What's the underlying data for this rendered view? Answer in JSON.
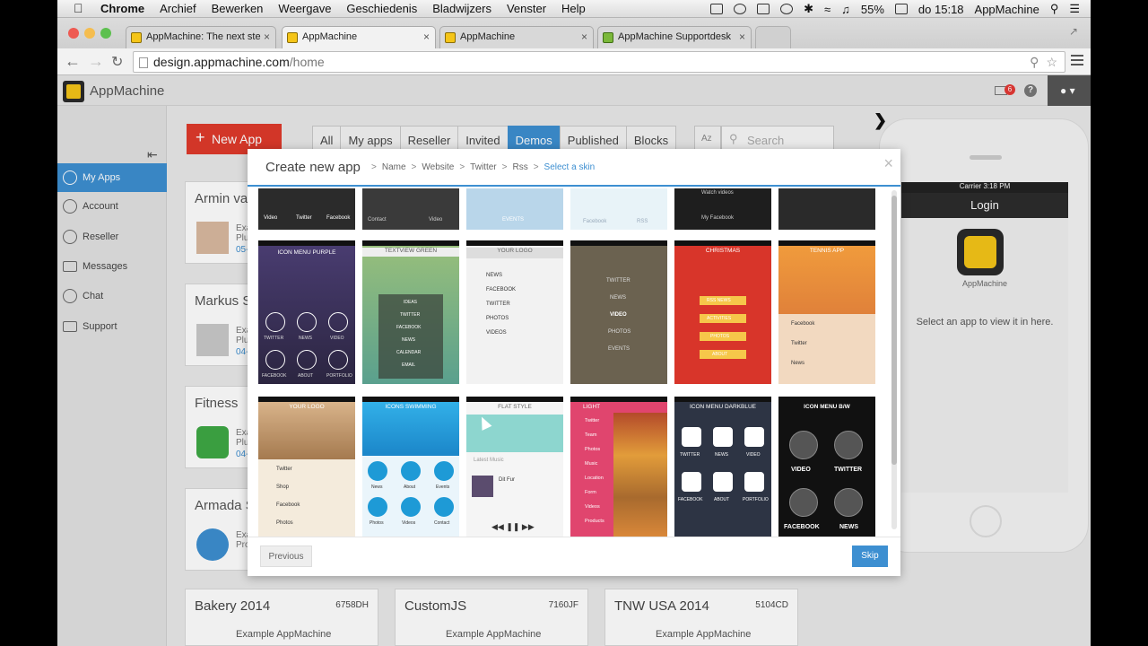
{
  "menubar": {
    "items": [
      "Chrome",
      "Archief",
      "Bewerken",
      "Weergave",
      "Geschiedenis",
      "Bladwijzers",
      "Venster",
      "Help"
    ],
    "battery": "55%",
    "clock": "do 15:18",
    "user": "AppMachine"
  },
  "tabs": [
    {
      "label": "AppMachine: The next ste"
    },
    {
      "label": "AppMachine"
    },
    {
      "label": "AppMachine"
    },
    {
      "label": "AppMachine Supportdesk"
    }
  ],
  "address": {
    "domain": "design.appmachine.com",
    "path": "/home"
  },
  "header": {
    "brand": "AppMachine",
    "mail_count": "6",
    "help": "?"
  },
  "sidebar": {
    "items": [
      {
        "label": "My Apps"
      },
      {
        "label": "Account"
      },
      {
        "label": "Reseller"
      },
      {
        "label": "Messages"
      },
      {
        "label": "Chat"
      },
      {
        "label": "Support"
      }
    ]
  },
  "main": {
    "new_app": "New App",
    "filters": [
      "All",
      "My apps",
      "Reseller",
      "Invited",
      "Demos",
      "Published",
      "Blocks"
    ],
    "sort_label": "Az",
    "search_placeholder": "Search",
    "cards": [
      {
        "title": "Armin va",
        "sub": "Exa\nPlu",
        "date": "05-"
      },
      {
        "title": "Markus S",
        "sub": "Exa\nPlu",
        "date": "04-"
      },
      {
        "title": "Fitness",
        "sub": "Exa\nPlu",
        "date": "04-"
      },
      {
        "title": "Armada S",
        "sub": "Exa\nPro",
        "date": ""
      }
    ],
    "bottom_cards": [
      {
        "title": "Bakery 2014",
        "code": "6758DH",
        "sub": "Example AppMachine"
      },
      {
        "title": "CustomJS",
        "code": "7160JF",
        "sub": "Example AppMachine"
      },
      {
        "title": "TNW USA 2014",
        "code": "5104CD",
        "sub": "Example AppMachine"
      }
    ]
  },
  "phone": {
    "carrier": "Carrier",
    "time": "3:18 PM",
    "screen_title": "Login",
    "app_name": "AppMachine",
    "hint": "Select an app to view it in here."
  },
  "modal": {
    "title": "Create new app",
    "steps": [
      "Name",
      "Website",
      "Twitter",
      "Rss",
      "Select a skin"
    ],
    "previous": "Previous",
    "skip": "Skip",
    "skins_row1": [
      {
        "labels": [
          "Video",
          "Twitter",
          "Facebook"
        ]
      },
      {
        "labels": [
          "Contact",
          "Video"
        ]
      },
      {
        "labels": [
          "EVENTS"
        ]
      },
      {
        "labels": [
          "Facebook",
          "RSS"
        ]
      },
      {
        "labels": [
          "Watch videos",
          "My Facebook"
        ]
      },
      {
        "labels": []
      }
    ],
    "skins_row2": [
      {
        "title": "ICON MENU PURPLE",
        "labels": [
          "TWITTER",
          "NEWS",
          "VIDEO",
          "FACEBOOK",
          "ABOUT",
          "PORTFOLIO"
        ]
      },
      {
        "title": "TEXTVIEW GREEN",
        "labels": [
          "IDEAS",
          "TWITTER",
          "FACEBOOK",
          "NEWS",
          "CALENDAR",
          "EMAIL"
        ]
      },
      {
        "title": "YOUR LOGO",
        "labels": [
          "NEWS",
          "FACEBOOK",
          "TWITTER",
          "PHOTOS",
          "VIDEOS"
        ]
      },
      {
        "title": "",
        "labels": [
          "TWITTER",
          "NEWS",
          "VIDEO",
          "PHOTOS",
          "EVENTS"
        ]
      },
      {
        "title": "CHRISTMAS",
        "labels": [
          "RSS NEWS",
          "ACTIVITIES",
          "PHOTOS",
          "ABOUT"
        ]
      },
      {
        "title": "Tennis app",
        "labels": [
          "Facebook",
          "Twitter",
          "News"
        ]
      }
    ],
    "skins_row3": [
      {
        "title": "Your logo",
        "labels": [
          "Twitter",
          "Shop",
          "Facebook",
          "Photos"
        ]
      },
      {
        "title": "ICONS SWIMMING",
        "labels": [
          "News",
          "About",
          "Events",
          "Photos",
          "Videos",
          "Contact"
        ]
      },
      {
        "title": "Flat Style",
        "labels": [
          "Latest Music",
          "Dit Fur"
        ]
      },
      {
        "title": "Light",
        "labels": [
          "Twitter",
          "Team",
          "Photos",
          "Music",
          "Location",
          "Form",
          "Videos",
          "Products"
        ]
      },
      {
        "title": "Icon menu DarkBlue",
        "labels": [
          "TWITTER",
          "NEWS",
          "VIDEO",
          "FACEBOOK",
          "ABOUT",
          "PORTFOLIO"
        ]
      },
      {
        "title": "ICON MENU B/W",
        "labels": [
          "VIDEO",
          "TWITTER",
          "FACEBOOK",
          "NEWS"
        ]
      }
    ]
  }
}
